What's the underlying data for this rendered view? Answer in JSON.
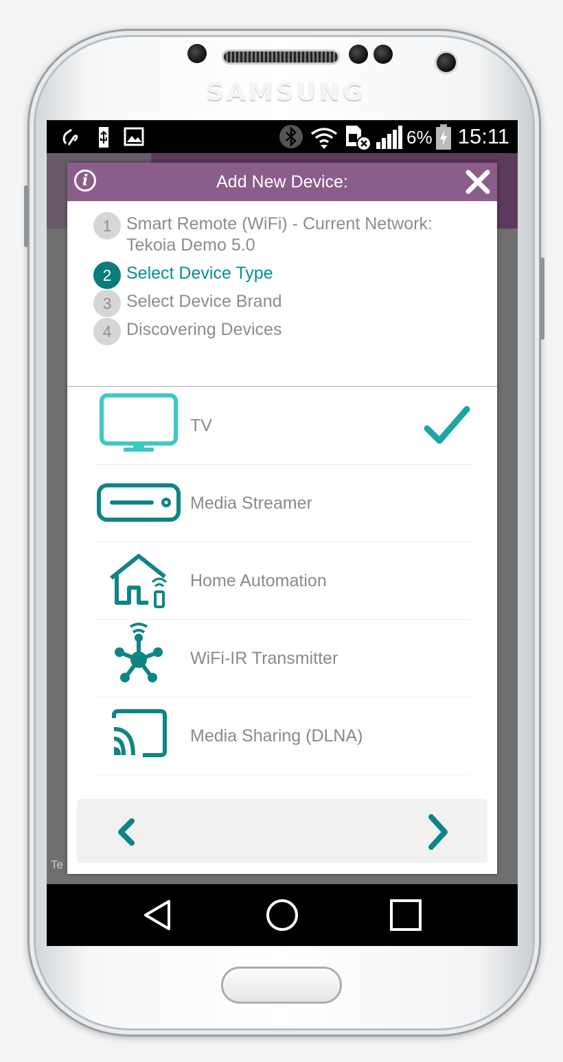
{
  "phone": {
    "brand": "SAMSUNG"
  },
  "status_bar": {
    "left_icons": [
      "nfc-icon",
      "usb-icon",
      "image-icon"
    ],
    "right_icons": [
      "bluetooth-icon",
      "wifi-icon",
      "sim-error-icon",
      "signal-icon",
      "battery-icon"
    ],
    "battery_percent": "6%",
    "time": "15:11"
  },
  "background": {
    "footer_fragment": "Te"
  },
  "dialog": {
    "title": "Add New Device:",
    "header_color": "#8a5d8b",
    "accent_color": "#0b7b7b",
    "steps": [
      {
        "number": "1",
        "label": "Smart Remote (WiFi) - Current Network: Tekoia Demo 5.0",
        "state": "done"
      },
      {
        "number": "2",
        "label": "Select Device Type",
        "state": "active"
      },
      {
        "number": "3",
        "label": "Select Device Brand",
        "state": "pending"
      },
      {
        "number": "4",
        "label": "Discovering Devices",
        "state": "pending"
      }
    ],
    "device_types": [
      {
        "label": "TV",
        "icon": "tv-icon",
        "selected": true
      },
      {
        "label": "Media Streamer",
        "icon": "media-streamer-icon",
        "selected": false
      },
      {
        "label": "Home Automation",
        "icon": "home-automation-icon",
        "selected": false
      },
      {
        "label": "WiFi-IR Transmitter",
        "icon": "wifi-ir-transmitter-icon",
        "selected": false
      },
      {
        "label": "Media Sharing (DLNA)",
        "icon": "cast-icon",
        "selected": false
      }
    ]
  },
  "navigation_bar": {
    "buttons": [
      "back-icon",
      "home-icon",
      "recents-icon"
    ]
  }
}
